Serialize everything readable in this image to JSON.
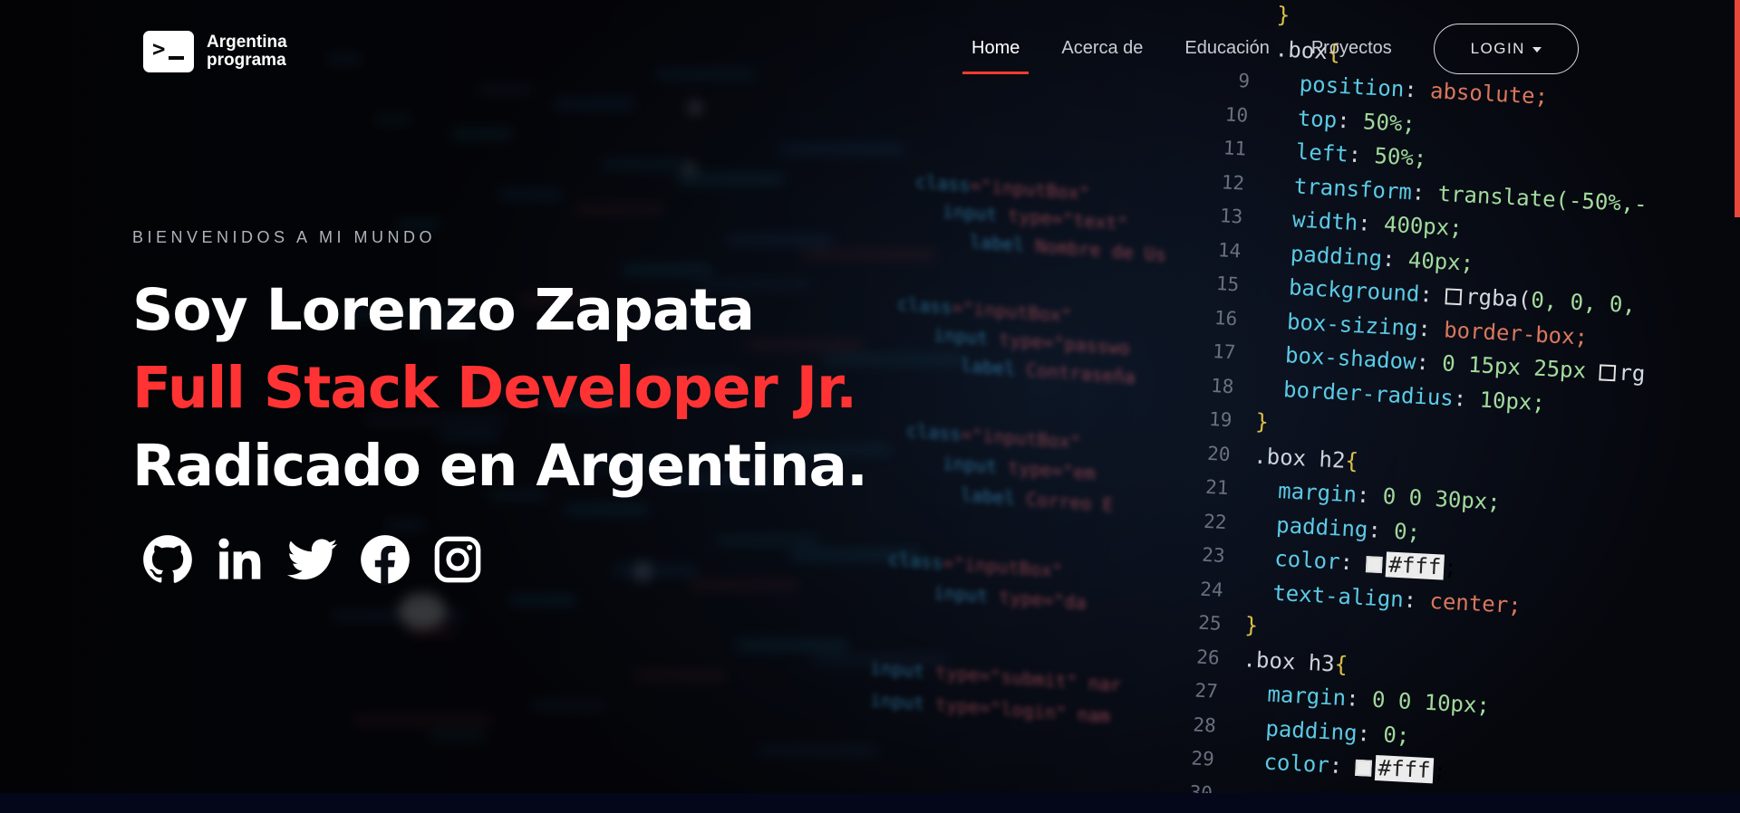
{
  "brand": {
    "logo_line1": "Argentina",
    "logo_line2": "programa"
  },
  "nav": {
    "items": [
      {
        "label": "Home",
        "active": true
      },
      {
        "label": "Acerca de",
        "active": false
      },
      {
        "label": "Educación",
        "active": false
      },
      {
        "label": "Proyectos",
        "active": false
      }
    ],
    "login_label": "LOGIN"
  },
  "hero": {
    "welcome": "BIENVENIDOS A MI MUNDO",
    "line1": "Soy Lorenzo Zapata",
    "line2": "Full Stack Developer Jr.",
    "line3": "Radicado en Argentina.",
    "accent_color": "#ff3333"
  },
  "socials": [
    {
      "name": "github",
      "icon": "github-icon"
    },
    {
      "name": "linkedin",
      "icon": "linkedin-icon"
    },
    {
      "name": "twitter",
      "icon": "twitter-icon"
    },
    {
      "name": "facebook",
      "icon": "facebook-icon"
    },
    {
      "name": "instagram",
      "icon": "instagram-icon"
    }
  ],
  "background_code": {
    "lines": [
      {
        "n": "",
        "text": "}"
      },
      {
        "n": "",
        "text": ".box{"
      },
      {
        "n": "9",
        "text": "  position: absolute;"
      },
      {
        "n": "10",
        "text": "  top: 50%;"
      },
      {
        "n": "11",
        "text": "  left: 50%;"
      },
      {
        "n": "12",
        "text": "  transform: translate(-50%,-"
      },
      {
        "n": "13",
        "text": "  width: 400px;"
      },
      {
        "n": "14",
        "text": "  padding: 40px;"
      },
      {
        "n": "15",
        "text": "  background: rgba(0, 0, 0,"
      },
      {
        "n": "16",
        "text": "  box-sizing: border-box;"
      },
      {
        "n": "17",
        "text": "  box-shadow: 0 15px 25px rg"
      },
      {
        "n": "18",
        "text": "  border-radius: 10px;"
      },
      {
        "n": "19",
        "text": "}"
      },
      {
        "n": "20",
        "text": ".box h2{"
      },
      {
        "n": "21",
        "text": "  margin: 0 0 30px;"
      },
      {
        "n": "22",
        "text": "  padding: 0;"
      },
      {
        "n": "23",
        "text": "  color: #fff;"
      },
      {
        "n": "24",
        "text": "  text-align: center;"
      },
      {
        "n": "25",
        "text": "}"
      },
      {
        "n": "26",
        "text": ".box h3{"
      },
      {
        "n": "27",
        "text": "  margin: 0 0 10px;"
      },
      {
        "n": "28",
        "text": "  padding: 0;"
      },
      {
        "n": "29",
        "text": "  color: #fff"
      },
      {
        "n": "30",
        "text": ""
      }
    ],
    "html_fragments": [
      "class=\"inputBox\"",
      "input type=\"text\"",
      "label Nombre de Us",
      "class=\"inputBox\"",
      "input type=\"passwo",
      "label Contraseña",
      "class=\"inputBox\"",
      "input type=\"em",
      "label Correo E",
      "class=\"inputBox\"",
      "input type=\"da",
      "input type=\"submit\" nar",
      "input type=\"login\" nam"
    ]
  }
}
